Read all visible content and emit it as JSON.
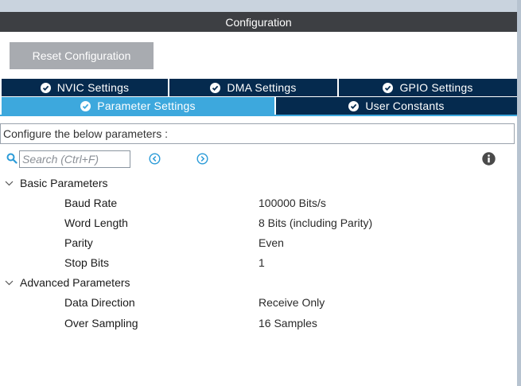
{
  "header": {
    "title": "Configuration"
  },
  "actions": {
    "reset_label": "Reset Configuration"
  },
  "tabs": {
    "row1": [
      {
        "label": "NVIC Settings",
        "active": false
      },
      {
        "label": "DMA Settings",
        "active": false
      },
      {
        "label": "GPIO Settings",
        "active": false
      }
    ],
    "row2": [
      {
        "label": "Parameter Settings",
        "active": true
      },
      {
        "label": "User Constants",
        "active": false
      }
    ]
  },
  "description": "Configure the below parameters :",
  "search": {
    "placeholder": "Search (Ctrl+F)"
  },
  "icons": {
    "search": "search-icon",
    "prev": "circle-arrow-left-icon",
    "next": "circle-arrow-right-icon",
    "info": "info-icon",
    "expand": "chevron-down-icon",
    "tab_check": "check-circle-icon"
  },
  "colors": {
    "header_bg": "#3d3f43",
    "tab_bg": "#052a4e",
    "tab_active_bg": "#3da8dd",
    "accent": "#2a9bd8",
    "button_bg": "#a8abb0"
  },
  "groups": [
    {
      "title": "Basic Parameters",
      "params": [
        {
          "label": "Baud Rate",
          "value": "100000 Bits/s"
        },
        {
          "label": "Word Length",
          "value": "8 Bits (including Parity)"
        },
        {
          "label": "Parity",
          "value": "Even"
        },
        {
          "label": "Stop Bits",
          "value": "1"
        }
      ]
    },
    {
      "title": "Advanced Parameters",
      "params": [
        {
          "label": "Data Direction",
          "value": "Receive Only"
        },
        {
          "label": "Over Sampling",
          "value": "16 Samples"
        }
      ]
    }
  ]
}
